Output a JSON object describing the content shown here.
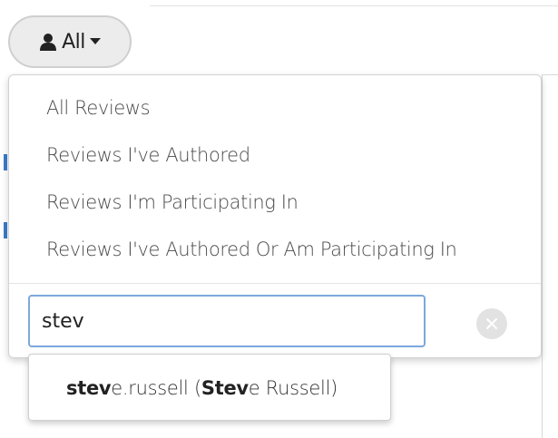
{
  "filter_button": {
    "label": "All",
    "icons": {
      "user": "user-icon",
      "caret": "caret-down-icon"
    }
  },
  "menu": {
    "items": [
      {
        "label": "All Reviews"
      },
      {
        "label": "Reviews I've Authored"
      },
      {
        "label": "Reviews I'm Participating In"
      },
      {
        "label": "Reviews I've Authored Or Am Participating In"
      }
    ],
    "user_search": {
      "value": "stev",
      "clear_icon": "clear-icon"
    }
  },
  "suggestion": {
    "username_match": "stev",
    "username_rest": "e.russell",
    "open_paren": " (",
    "fullname_match": "Stev",
    "fullname_rest": "e Russell",
    "close_paren": ")"
  },
  "colors": {
    "input_focus_border": "#7da8dd",
    "button_background": "#ececec",
    "text": "#333333"
  }
}
